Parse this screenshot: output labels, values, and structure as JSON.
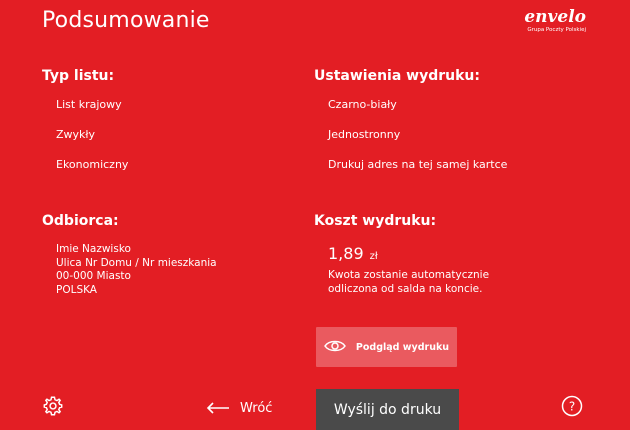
{
  "header": {
    "title": "Podsumowanie",
    "logo_text": "envelo",
    "logo_sub": "Grupa Poczty Polskiej"
  },
  "letter_type": {
    "heading": "Typ listu:",
    "items": [
      "List krajowy",
      "Zwykły",
      "Ekonomiczny"
    ]
  },
  "print_settings": {
    "heading": "Ustawienia wydruku:",
    "items": [
      "Czarno-biały",
      "Jednostronny",
      "Drukuj adres na tej samej kartce"
    ]
  },
  "recipient": {
    "heading": "Odbiorca:",
    "lines": [
      "Imie Nazwisko",
      "Ulica Nr Domu / Nr mieszkania",
      "00-000 Miasto",
      "POLSKA"
    ]
  },
  "cost": {
    "heading": "Koszt wydruku:",
    "value": "1,89",
    "currency": "zł",
    "note": "Kwota zostanie automatycznie odliczona od salda na koncie."
  },
  "actions": {
    "preview_label": "Podgląd wydruku",
    "back_label": "Wróć",
    "send_label": "Wyślij do druku"
  },
  "icons": {
    "settings": "gear-icon",
    "help": "help-icon",
    "back": "arrow-left-icon",
    "preview": "eye-icon"
  },
  "colors": {
    "background": "#e31e24",
    "preview_button": "#ea5a5f",
    "send_button": "#4a4a4a"
  }
}
